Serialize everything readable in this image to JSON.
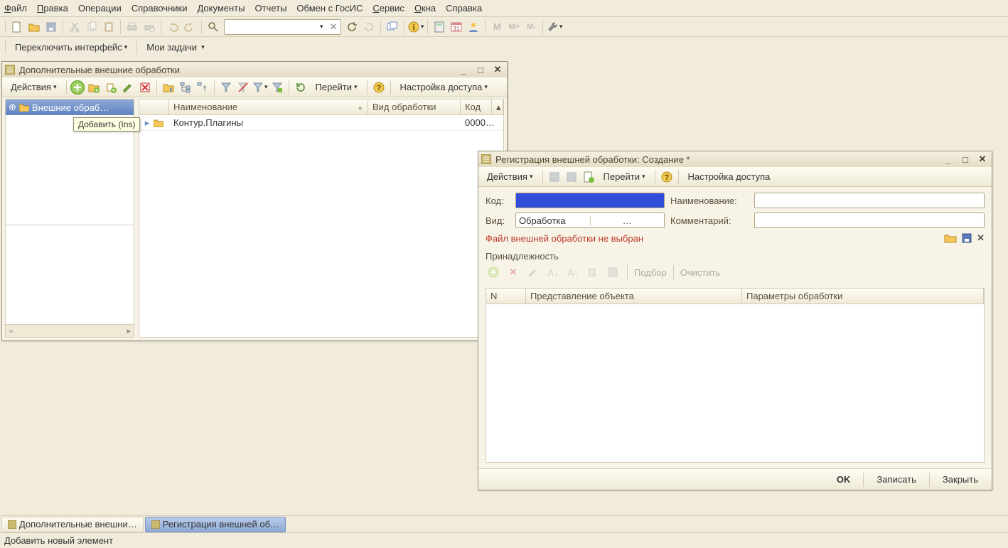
{
  "menu": {
    "file": "Файл",
    "edit": "Правка",
    "ops": "Операции",
    "refs": "Справочники",
    "docs": "Документы",
    "reports": "Отчеты",
    "exchange": "Обмен с ГосИС",
    "service": "Сервис",
    "windows": "Окна",
    "help": "Справка"
  },
  "toolbar2": {
    "switch": "Переключить интерфейс",
    "tasks": "Мои задачи"
  },
  "win1": {
    "title": "Дополнительные внешние обработки",
    "actions": "Действия",
    "goto": "Перейти",
    "access": "Настройка доступа",
    "tooltip": "Добавить (Ins)",
    "tree_root": "Внешние обраб…",
    "cols": {
      "name": "Наименование",
      "type": "Вид обработки",
      "code": "Код"
    },
    "row": {
      "name": "Контур.Плагины",
      "type": "",
      "code": "0000…"
    }
  },
  "win2": {
    "title": "Регистрация внешней обработки: Создание *",
    "actions": "Действия",
    "goto": "Перейти",
    "access": "Настройка доступа",
    "labels": {
      "code": "Код:",
      "name": "Наименование:",
      "type": "Вид:",
      "comment": "Комментарий:"
    },
    "values": {
      "type": "Обработка"
    },
    "warn": "Файл внешней обработки не выбран",
    "section": "Принадлежность",
    "tb": {
      "select": "Подбор",
      "clear": "Очистить"
    },
    "cols": {
      "n": "N",
      "repr": "Представление объекта",
      "params": "Параметры обработки"
    },
    "btns": {
      "ok": "OK",
      "save": "Записать",
      "close": "Закрыть"
    }
  },
  "taskbar": {
    "t1": "Дополнительные внешни…",
    "t2": "Регистрация внешней об…"
  },
  "status": "Добавить новый элемент"
}
